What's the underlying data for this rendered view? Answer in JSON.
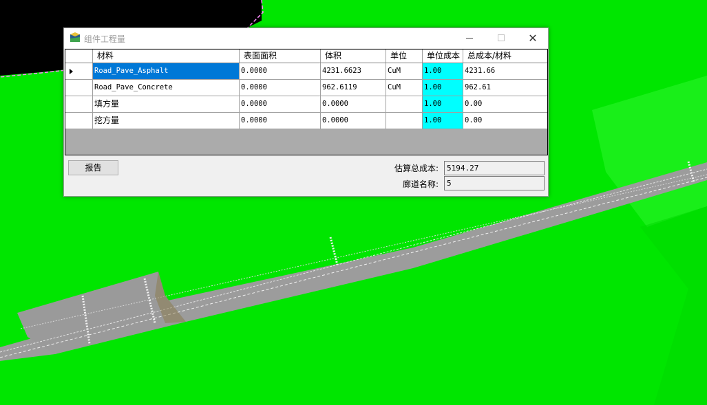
{
  "window": {
    "title": "组件工程量"
  },
  "grid": {
    "columns": [
      "材料",
      "表面面积",
      "体积",
      "单位",
      "单位成本",
      "总成本/材料"
    ],
    "rows": [
      {
        "material": "Road_Pave_Asphalt",
        "area": "0.0000",
        "volume": "4231.6623",
        "unit": "CuM",
        "unit_cost": "1.00",
        "total": "4231.66",
        "selected": true
      },
      {
        "material": "Road_Pave_Concrete",
        "area": "0.0000",
        "volume": "962.6119",
        "unit": "CuM",
        "unit_cost": "1.00",
        "total": "962.61"
      },
      {
        "material": "填方量",
        "area": "0.0000",
        "volume": "0.0000",
        "unit": "",
        "unit_cost": "1.00",
        "total": "0.00"
      },
      {
        "material": "挖方量",
        "area": "0.0000",
        "volume": "0.0000",
        "unit": "",
        "unit_cost": "1.00",
        "total": "0.00"
      }
    ]
  },
  "footer": {
    "report_label": "报告",
    "total_cost_label": "估算总成本:",
    "total_cost_value": "5194.27",
    "corridor_label": "廊道名称:",
    "corridor_value": "5"
  },
  "colors": {
    "terrain": "#00e600",
    "selection": "#0078d7",
    "cost_cell": "#00ffff",
    "road": "#9c9c9c"
  }
}
